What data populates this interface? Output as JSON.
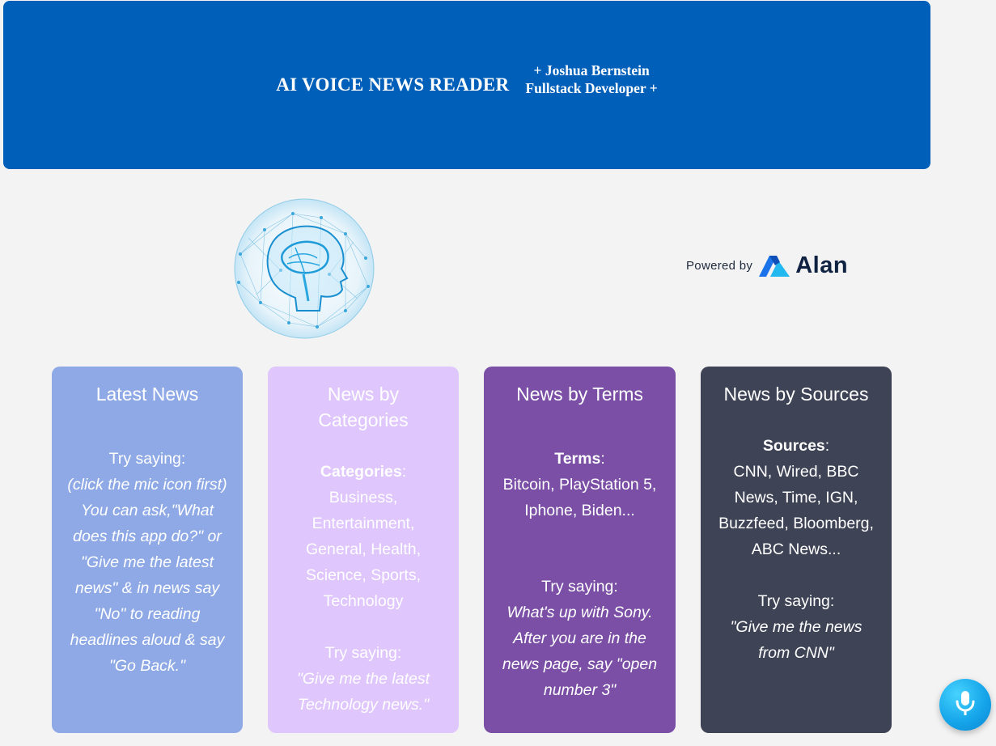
{
  "header": {
    "title": "AI VOICE NEWS READER",
    "byline_line1": "+ Joshua Bernstein",
    "byline_line2": "Fullstack Developer +"
  },
  "powered": {
    "prefix": "Powered by",
    "brand": "Alan",
    "icon": "alan-logo-icon"
  },
  "brain_image": {
    "icon": "brain-network-sphere-image"
  },
  "cards": [
    {
      "title": "Latest News",
      "try_label": "Try saying:",
      "example": "(click the mic icon first) You can ask,\"What does this app do?\" or \"Give me the latest news\" & in news say \"No\" to reading headlines aloud & say \"Go Back.\"",
      "color": "#8ea9e5"
    },
    {
      "title": "News by Categories",
      "info_label": "Categories",
      "info_sep": ":",
      "info_text": "Business, Entertainment, General, Health, Science, Sports, Technology",
      "try_label": "Try saying:",
      "example": "\"Give me the latest Technology news.\"",
      "color": "#dfc6fc"
    },
    {
      "title": "News by Terms",
      "info_label": "Terms",
      "info_sep": ":",
      "info_text": "Bitcoin, PlayStation 5, Iphone, Biden...",
      "try_label": "Try saying:",
      "example": "What's up with Sony. After you are in the news page, say \"open number 3\"",
      "color": "#7a4fa5"
    },
    {
      "title": "News by Sources",
      "info_label": "Sources",
      "info_sep": ":",
      "info_text": "CNN, Wired, BBC News, Time, IGN, Buzzfeed, Bloomberg, ABC News...",
      "try_label": "Try saying:",
      "example": "\"Give me the news from CNN\"",
      "color": "#3e4355"
    }
  ],
  "mic_button": {
    "icon": "microphone-icon"
  }
}
